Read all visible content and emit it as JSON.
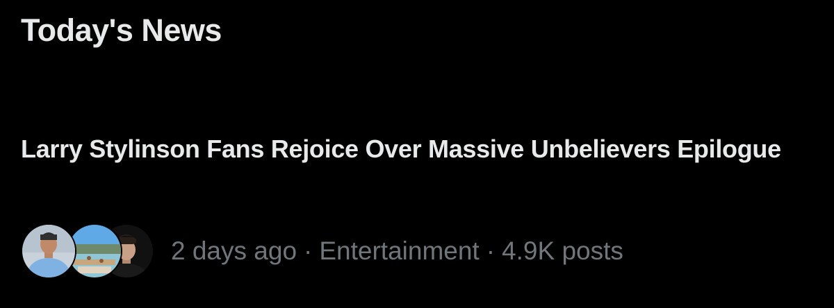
{
  "section": {
    "title": "Today's News"
  },
  "news_item": {
    "headline": "Larry Stylinson Fans Rejoice Over Massive Unbelievers Epilogue",
    "time_ago": "2 days ago",
    "separator": "·",
    "category": "Entertainment",
    "post_count": "4.9K posts",
    "avatars": [
      {
        "icon": "person-blue-hoodie-avatar"
      },
      {
        "icon": "beach-scene-avatar"
      },
      {
        "icon": "person-dark-avatar"
      }
    ]
  },
  "colors": {
    "background": "#000000",
    "primary_text": "#e7e9ea",
    "secondary_text": "#71767b"
  }
}
